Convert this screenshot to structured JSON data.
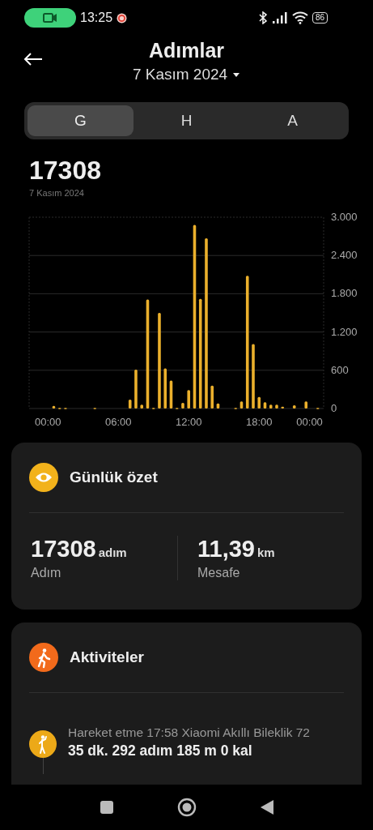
{
  "status_bar": {
    "time": "13:25",
    "battery": "86"
  },
  "header": {
    "title": "Adımlar",
    "date": "7 Kasım 2024"
  },
  "tabs": [
    {
      "label": "G",
      "selected": true
    },
    {
      "label": "H",
      "selected": false
    },
    {
      "label": "A",
      "selected": false
    }
  ],
  "total": {
    "value": "17308",
    "date": "7 Kasım 2024"
  },
  "chart": {
    "chart_data": {
      "type": "bar",
      "x": [
        0.5,
        1,
        1.5,
        4,
        7,
        7.5,
        8,
        8.5,
        9,
        9.5,
        10,
        10.5,
        11,
        11.5,
        12,
        12.5,
        13,
        13.5,
        14,
        14.5,
        16,
        16.5,
        17,
        17.5,
        18,
        18.5,
        19,
        19.5,
        20,
        21,
        22,
        23
      ],
      "series": [
        {
          "color": "#ebb02c",
          "values": [
            40,
            10,
            10,
            10,
            140,
            610,
            60,
            1710,
            10,
            1500,
            630,
            440,
            10,
            90,
            290,
            2880,
            1720,
            2670,
            360,
            80,
            10,
            110,
            2080,
            1010,
            180,
            100,
            60,
            60,
            30,
            50,
            110,
            10
          ]
        }
      ],
      "xlim": [
        -1.6,
        23.5
      ],
      "ylim": [
        0,
        3000
      ],
      "grid": true,
      "xticks": [
        {
          "value": 0,
          "label": "00:00"
        },
        {
          "value": 6,
          "label": "06:00"
        },
        {
          "value": 12,
          "label": "12:00"
        },
        {
          "value": 18,
          "label": "18:00"
        },
        {
          "value": 22.3,
          "label": "00:00"
        }
      ],
      "yticks": [
        {
          "value": 0,
          "label": "0"
        },
        {
          "value": 600,
          "label": "600"
        },
        {
          "value": 1200,
          "label": "1.200"
        },
        {
          "value": 1800,
          "label": "1.800"
        },
        {
          "value": 2400,
          "label": "2.400"
        },
        {
          "value": 3000,
          "label": "3.000"
        }
      ]
    }
  },
  "summary": {
    "title": "Günlük özet",
    "stats": [
      {
        "value": "17308",
        "unit": "adım",
        "label": "Adım"
      },
      {
        "value": "11,39",
        "unit": "km",
        "label": "Mesafe"
      }
    ]
  },
  "activities": {
    "title": "Aktiviteler",
    "items": [
      {
        "title": "Hareket etme 17:58 Xiaomi Akıllı Bileklik 72",
        "details": "35 dk. 292 adım 185 m 0 kal"
      }
    ]
  }
}
